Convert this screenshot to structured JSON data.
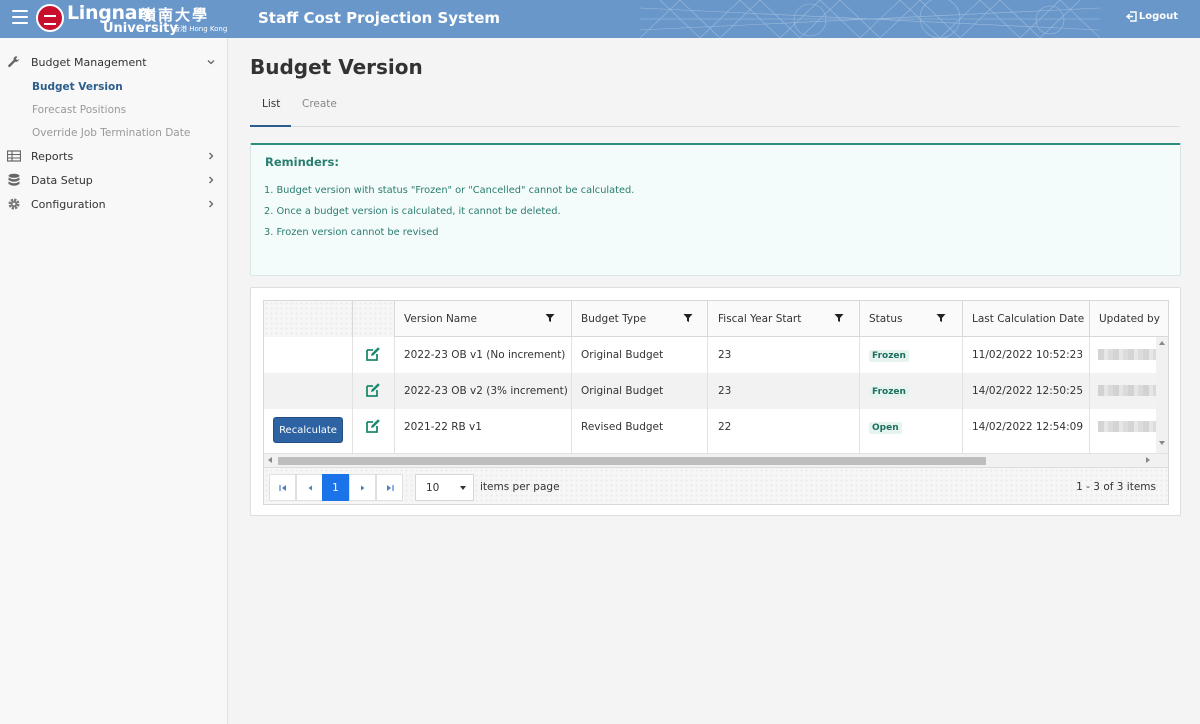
{
  "header": {
    "logo_name": "Lingnan",
    "logo_cn": "嶺南大學",
    "logo_sub": "University",
    "logo_sub2": "香港 Hong Kong",
    "app_title": "Staff Cost Projection System",
    "logout_label": "Logout"
  },
  "sidebar": {
    "budget_management": "Budget Management",
    "sub_items": [
      "Budget Version",
      "Forecast Positions",
      "Override Job Termination Date"
    ],
    "reports": "Reports",
    "data_setup": "Data Setup",
    "configuration": "Configuration"
  },
  "page": {
    "title": "Budget Version",
    "tabs": [
      "List",
      "Create"
    ]
  },
  "reminders": {
    "title": "Reminders:",
    "lines": [
      "1. Budget version with status \"Frozen\" or \"Cancelled\" cannot be calculated.",
      "2. Once a budget version is calculated, it cannot be deleted.",
      "3. Frozen version cannot be revised"
    ]
  },
  "grid": {
    "columns": [
      "Version Name",
      "Budget Type",
      "Fiscal Year Start",
      "Status",
      "Last Calculation Date",
      "Updated by"
    ],
    "rows": [
      {
        "action": "",
        "version": "2022-23 OB v1 (No increment)",
        "type": "Original Budget",
        "fy": "23",
        "status": "Frozen",
        "calc": "11/02/2022 10:52:23"
      },
      {
        "action": "",
        "version": "2022-23 OB v2 (3% increment)",
        "type": "Original Budget",
        "fy": "23",
        "status": "Frozen",
        "calc": "14/02/2022 12:50:25"
      },
      {
        "action": "Recalculate",
        "version": "2021-22 RB v1",
        "type": "Revised Budget",
        "fy": "22",
        "status": "Open",
        "calc": "14/02/2022 12:54:09"
      }
    ]
  },
  "pager": {
    "current_page": "1",
    "page_size": "10",
    "per_page_label": "items per page",
    "info": "1 - 3 of 3 items"
  },
  "colors": {
    "header_bg": "#6a97c9",
    "accent_teal": "#2a7d6f",
    "active_nav": "#2b5e8c",
    "button_blue": "#2d63a3",
    "page_active": "#1a73e8"
  }
}
